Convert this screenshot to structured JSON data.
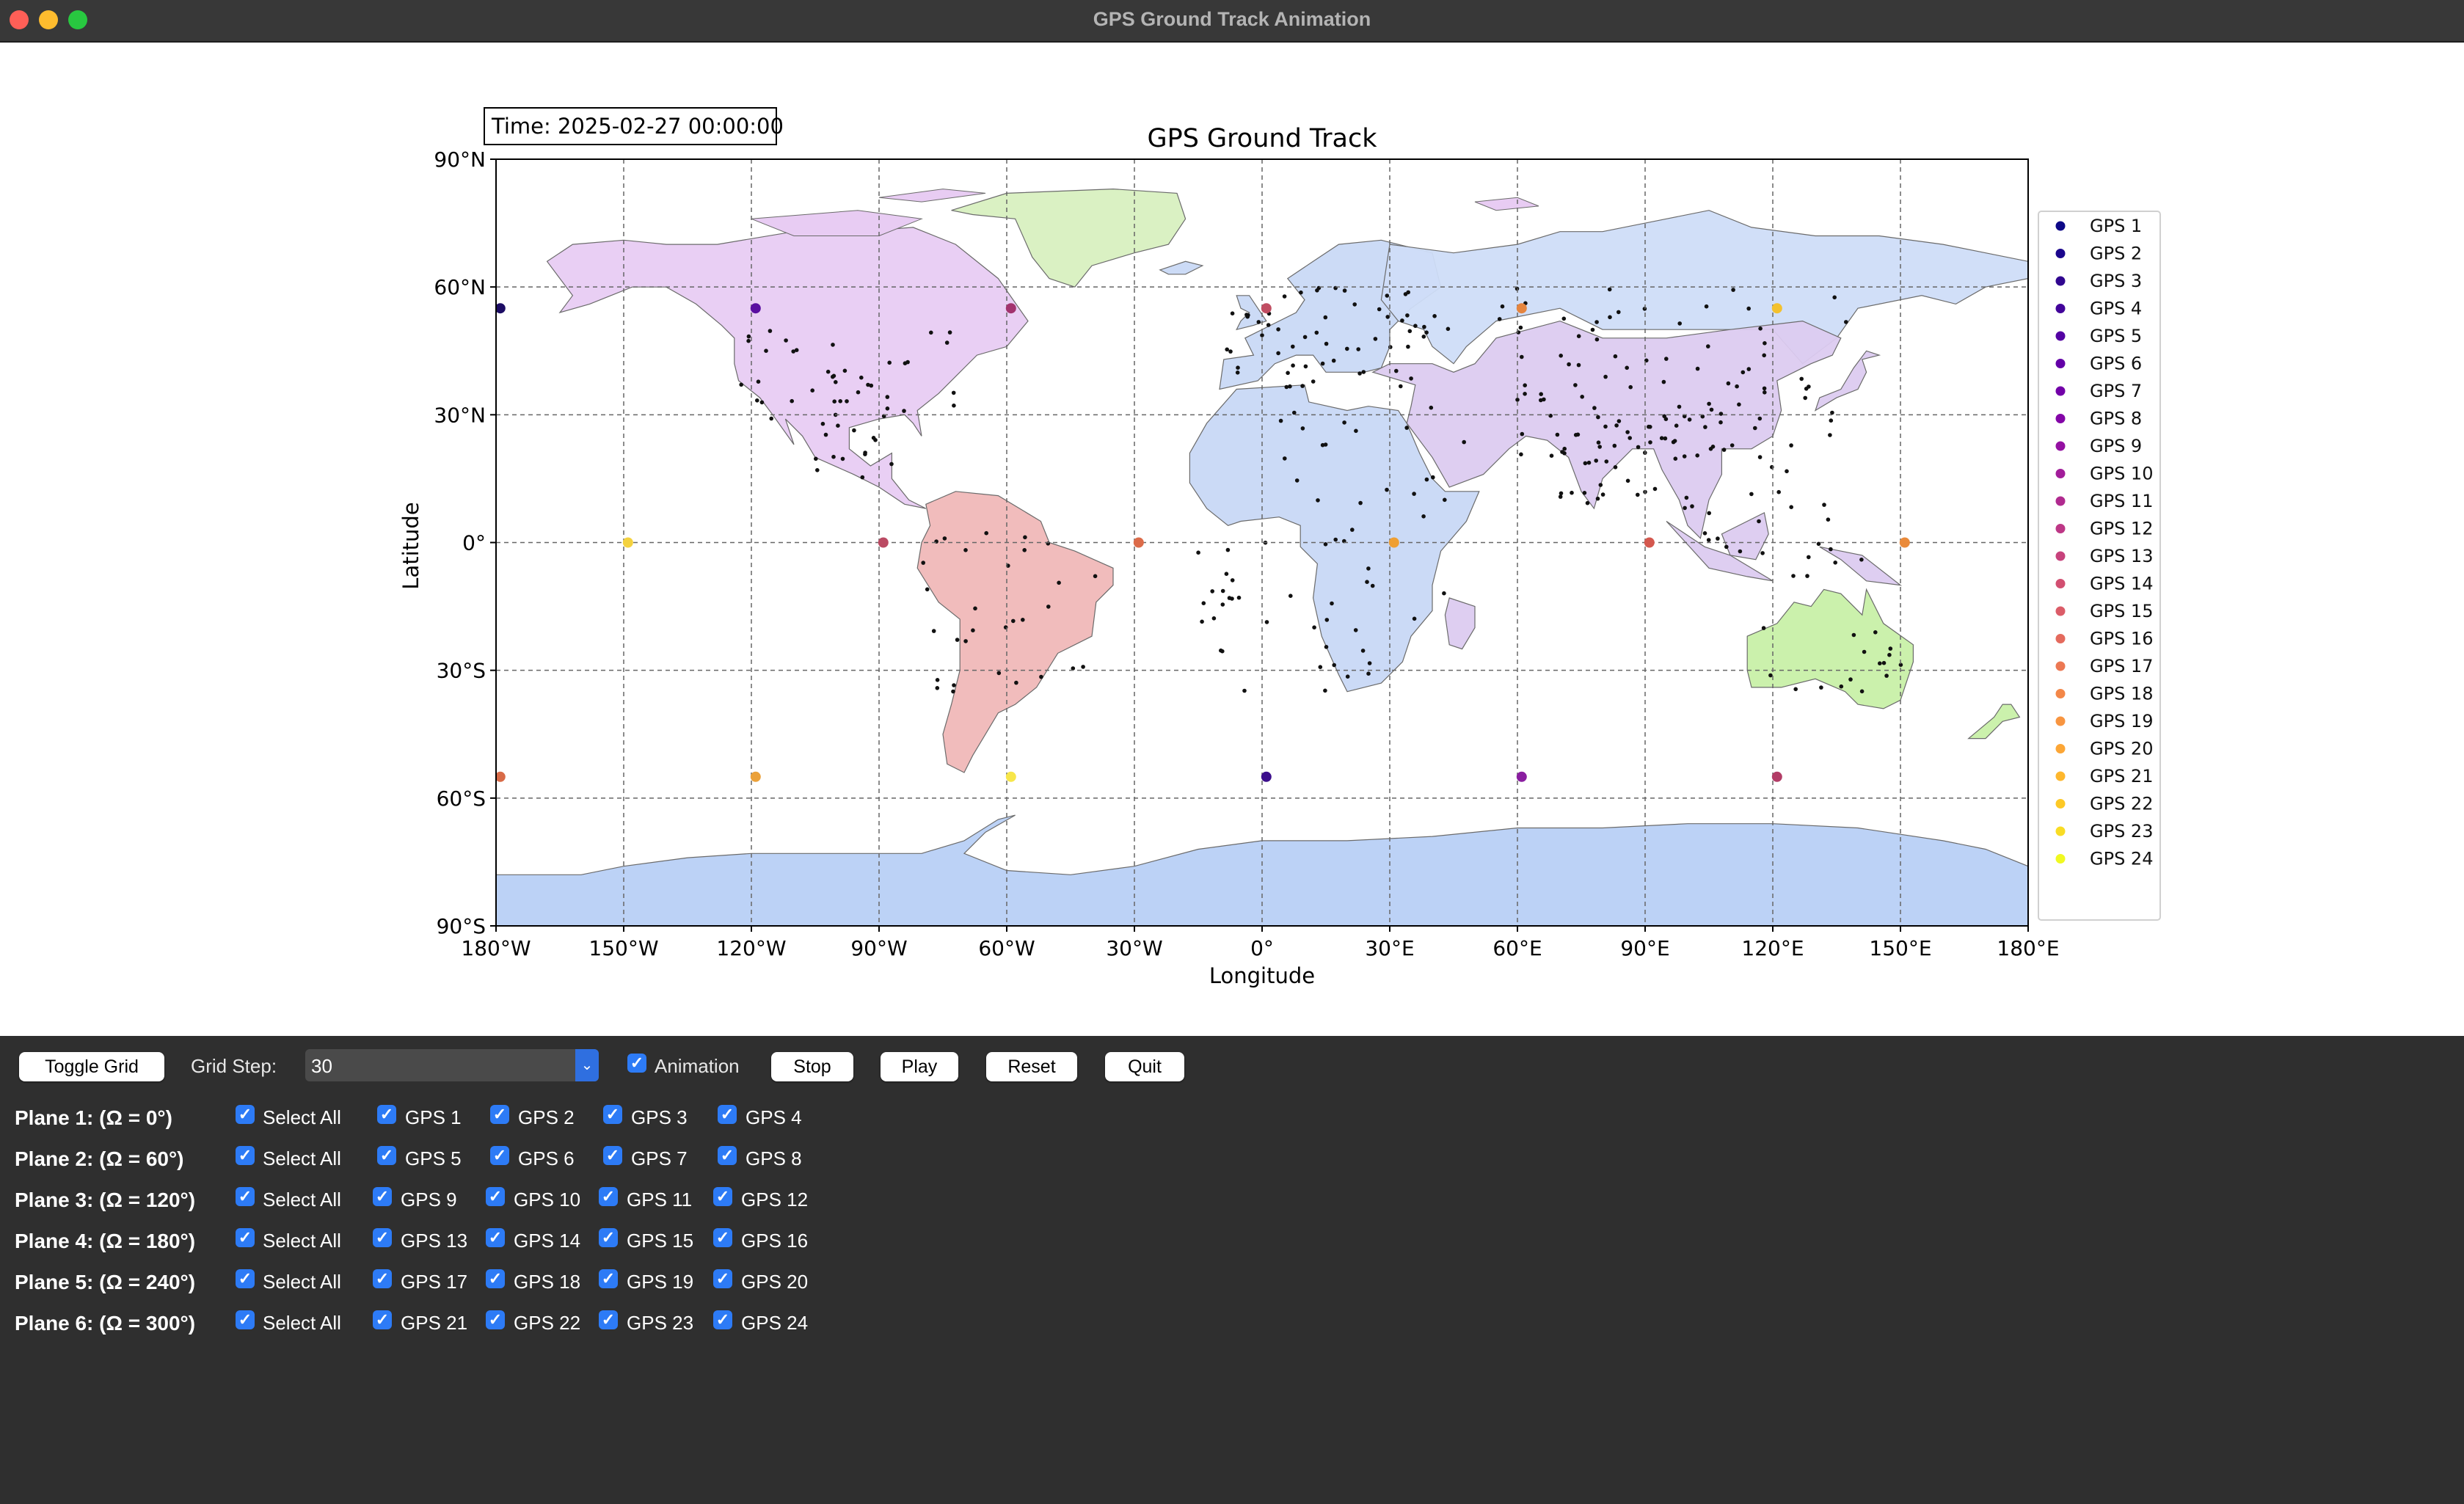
{
  "window": {
    "title": "GPS Ground Track Animation"
  },
  "plot": {
    "title": "GPS Ground Track",
    "time_label": "Time: 2025-02-27 00:00:00",
    "xlabel": "Longitude",
    "ylabel": "Latitude",
    "x_ticks": [
      "180°W",
      "150°W",
      "120°W",
      "90°W",
      "60°W",
      "30°W",
      "0°",
      "30°E",
      "60°E",
      "90°E",
      "120°E",
      "150°E",
      "180°E"
    ],
    "y_ticks": [
      "90°N",
      "60°N",
      "30°N",
      "0°",
      "30°S",
      "60°S",
      "90°S"
    ],
    "legend": [
      "GPS 1",
      "GPS 2",
      "GPS 3",
      "GPS 4",
      "GPS 5",
      "GPS 6",
      "GPS 7",
      "GPS 8",
      "GPS 9",
      "GPS 10",
      "GPS 11",
      "GPS 12",
      "GPS 13",
      "GPS 14",
      "GPS 15",
      "GPS 16",
      "GPS 17",
      "GPS 18",
      "GPS 19",
      "GPS 20",
      "GPS 21",
      "GPS 22",
      "GPS 23",
      "GPS 24"
    ],
    "legend_placement": "outside-right",
    "grid": true
  },
  "chart_data": {
    "type": "scatter",
    "xlabel": "Longitude",
    "ylabel": "Latitude",
    "xlim": [
      -180,
      180
    ],
    "ylim": [
      -90,
      90
    ],
    "points": [
      {
        "lon": -179,
        "lat": 55,
        "color": "#1c0c64"
      },
      {
        "lon": -119,
        "lat": 55,
        "color": "#5a0fa0"
      },
      {
        "lon": -59,
        "lat": 55,
        "color": "#a2336e"
      },
      {
        "lon": 1,
        "lat": 55,
        "color": "#c04d62"
      },
      {
        "lon": 61,
        "lat": 55,
        "color": "#e5853f"
      },
      {
        "lon": 121,
        "lat": 55,
        "color": "#f3c12e"
      },
      {
        "lon": -149,
        "lat": 0,
        "color": "#f4d23f"
      },
      {
        "lon": -89,
        "lat": 0,
        "color": "#bb4a63"
      },
      {
        "lon": -29,
        "lat": 0,
        "color": "#dc6b49"
      },
      {
        "lon": 31,
        "lat": 0,
        "color": "#ef9f33"
      },
      {
        "lon": 91,
        "lat": 0,
        "color": "#d4584e"
      },
      {
        "lon": 151,
        "lat": 0,
        "color": "#ea8a3a"
      },
      {
        "lon": -179,
        "lat": -55,
        "color": "#d86a47"
      },
      {
        "lon": -119,
        "lat": -55,
        "color": "#eba13a"
      },
      {
        "lon": -59,
        "lat": -55,
        "color": "#f7e64a"
      },
      {
        "lon": 1,
        "lat": -55,
        "color": "#3c0e8c"
      },
      {
        "lon": 61,
        "lat": -55,
        "color": "#8a1ea0"
      },
      {
        "lon": 121,
        "lat": -55,
        "color": "#b23c66"
      }
    ],
    "legend_colors": [
      "#0d0887",
      "#1b068d",
      "#30068f",
      "#42049a",
      "#5302a3",
      "#6300a7",
      "#7201a8",
      "#8305a7",
      "#9410a2",
      "#a21d9a",
      "#b02a8f",
      "#bd3786",
      "#c7427c",
      "#d24f71",
      "#db5c68",
      "#e46a5d",
      "#ec7853",
      "#f38748",
      "#f89540",
      "#fca636",
      "#feb72d",
      "#fdc926",
      "#f9dc24",
      "#f0f921"
    ],
    "land_colors": {
      "north_america": "#e8ccf3",
      "greenland": "#d8f0c0",
      "south_america": "#f0b8b8",
      "europe": "#c9d9f5",
      "russia": "#cfddf8",
      "africa": "#c8d8f6",
      "asia": "#dccbf0",
      "australia": "#c8f0a8",
      "antarctica": "#b8d0f5"
    }
  },
  "controls": {
    "toggle_grid": "Toggle Grid",
    "grid_step_label": "Grid Step:",
    "grid_step_value": "30",
    "animation_label": "Animation",
    "stop": "Stop",
    "play": "Play",
    "reset": "Reset",
    "quit": "Quit"
  },
  "planes": [
    {
      "label": "Plane 1: (Ω = 0°)",
      "select_all": "Select All",
      "sats": [
        "GPS 1",
        "GPS 2",
        "GPS 3",
        "GPS 4"
      ]
    },
    {
      "label": "Plane 2: (Ω = 60°)",
      "select_all": "Select All",
      "sats": [
        "GPS 5",
        "GPS 6",
        "GPS 7",
        "GPS 8"
      ]
    },
    {
      "label": "Plane 3: (Ω = 120°)",
      "select_all": "Select All",
      "sats": [
        "GPS 9",
        "GPS 10",
        "GPS 11",
        "GPS 12"
      ]
    },
    {
      "label": "Plane 4: (Ω = 180°)",
      "select_all": "Select All",
      "sats": [
        "GPS 13",
        "GPS 14",
        "GPS 15",
        "GPS 16"
      ]
    },
    {
      "label": "Plane 5: (Ω = 240°)",
      "select_all": "Select All",
      "sats": [
        "GPS 17",
        "GPS 18",
        "GPS 19",
        "GPS 20"
      ]
    },
    {
      "label": "Plane 6: (Ω = 300°)",
      "select_all": "Select All",
      "sats": [
        "GPS 21",
        "GPS 22",
        "GPS 23",
        "GPS 24"
      ]
    }
  ]
}
